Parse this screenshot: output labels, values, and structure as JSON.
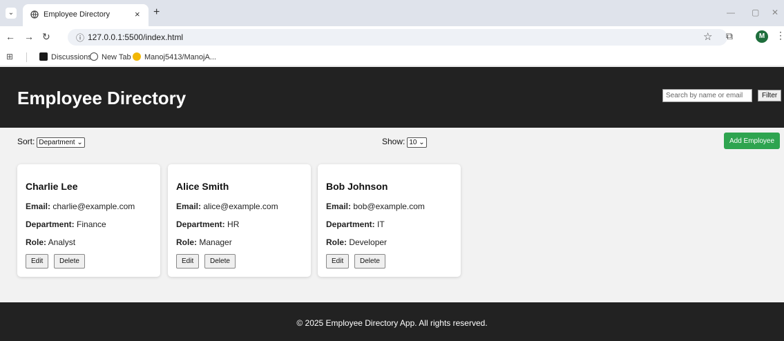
{
  "browser": {
    "tab_title": "Employee Directory",
    "tab_close": "×",
    "new_tab": "+",
    "url": "127.0.0.1:5500/index.html",
    "profile_initial": "M",
    "bookmarks": [
      {
        "label": "Discussions"
      },
      {
        "label": "New Tab"
      },
      {
        "label": "Manoj5413/ManojA..."
      }
    ]
  },
  "header": {
    "title": "Employee Directory",
    "search_placeholder": "Search by name or email",
    "filter_label": "Filter"
  },
  "controls": {
    "sort_label": "Sort:",
    "sort_value": "Department",
    "show_label": "Show:",
    "show_value": "10",
    "add_label": "Add Employee"
  },
  "labels": {
    "email": "Email:",
    "department": "Department:",
    "role": "Role:",
    "edit": "Edit",
    "delete": "Delete"
  },
  "employees": [
    {
      "name": "Charlie Lee",
      "email": "charlie@example.com",
      "department": "Finance",
      "role": "Analyst"
    },
    {
      "name": "Alice Smith",
      "email": "alice@example.com",
      "department": "HR",
      "role": "Manager"
    },
    {
      "name": "Bob Johnson",
      "email": "bob@example.com",
      "department": "IT",
      "role": "Developer"
    }
  ],
  "footer": {
    "text": "© 2025 Employee Directory App. All rights reserved."
  },
  "colors": {
    "header_bg": "#222222",
    "add_button": "#2ea44f"
  }
}
